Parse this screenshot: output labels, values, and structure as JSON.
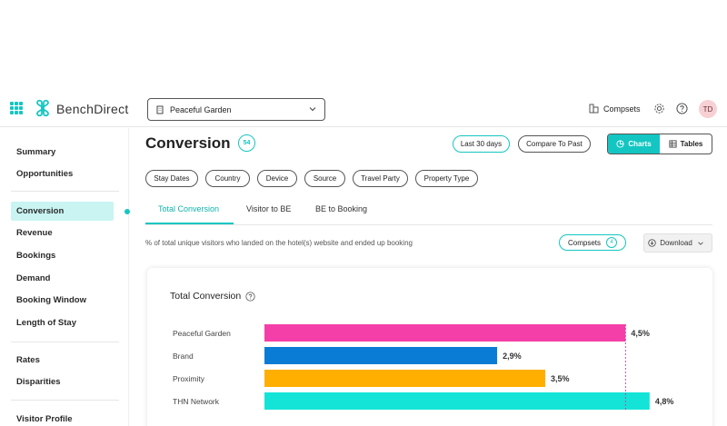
{
  "app": {
    "name": "BenchDirect",
    "hotel": "Peaceful Garden",
    "compsets_label": "Compsets",
    "user_initials": "TD"
  },
  "sidebar": {
    "items": [
      "Summary",
      "Opportunities",
      "Conversion",
      "Revenue",
      "Bookings",
      "Demand",
      "Booking Window",
      "Length of Stay",
      "Rates",
      "Disparities",
      "Visitor Profile"
    ],
    "active": "Conversion"
  },
  "header": {
    "title": "Conversion",
    "score": "54",
    "period": "Last 30 days",
    "compare": "Compare To Past",
    "view_charts": "Charts",
    "view_tables": "Tables"
  },
  "filters": [
    "Stay Dates",
    "Country",
    "Device",
    "Source",
    "Travel Party",
    "Property Type"
  ],
  "tabs": [
    "Total Conversion",
    "Visitor to BE",
    "BE to Booking"
  ],
  "description": "% of total unique visitors who landed on the hotel(s) website and ended up booking",
  "toolbar": {
    "compsets": "Compsets",
    "compsets_count": "4",
    "download": "Download"
  },
  "card": {
    "title": "Total Conversion"
  },
  "colors": {
    "accent": "#14c6c2",
    "peaceful_garden": "#f53fa8",
    "brand": "#0a7cd6",
    "proximity": "#ffaf00",
    "thn_network": "#14e4d8"
  },
  "chart_data": {
    "type": "bar",
    "orientation": "horizontal",
    "title": "Total Conversion",
    "categories": [
      "Peaceful Garden",
      "Brand",
      "Proximity",
      "THN Network"
    ],
    "values": [
      4.5,
      2.9,
      3.5,
      4.8
    ],
    "value_labels": [
      "4,5%",
      "2,9%",
      "3,5%",
      "4,8%"
    ],
    "unit": "%",
    "colors": [
      "#f53fa8",
      "#0a7cd6",
      "#ffaf00",
      "#14e4d8"
    ],
    "reference_line_value": 4.5,
    "xlim": [
      0,
      5
    ]
  }
}
